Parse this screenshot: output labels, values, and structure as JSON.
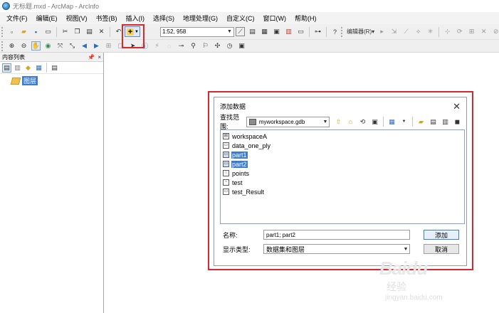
{
  "window": {
    "title": "无标题.mxd - ArcMap - ArcInfo"
  },
  "menubar": {
    "items": [
      {
        "label": "文件(F)"
      },
      {
        "label": "编辑(E)"
      },
      {
        "label": "视图(V)"
      },
      {
        "label": "书签(B)"
      },
      {
        "label": "插入(I)"
      },
      {
        "label": "选择(S)"
      },
      {
        "label": "地理处理(G)"
      },
      {
        "label": "自定义(C)"
      },
      {
        "label": "窗口(W)"
      },
      {
        "label": "帮助(H)"
      }
    ]
  },
  "toolbar": {
    "scale_value": "1:52, 958",
    "editor_label": "编辑器(R)▾"
  },
  "toc": {
    "title": "内容列表",
    "pin_label": "📌",
    "close_label": "×",
    "layers_label": "图层"
  },
  "dialog": {
    "title": "添加数据",
    "look_in_label": "查找范围:",
    "look_in_value": "myworkspace.gdb",
    "files": [
      {
        "name": "workspaceA",
        "icon": "feature-dataset-icon",
        "selected": false
      },
      {
        "name": "data_one_ply",
        "icon": "polygon-feature-class-icon",
        "selected": false
      },
      {
        "name": "part1",
        "icon": "polygon-feature-class-icon",
        "selected": true
      },
      {
        "name": "part2",
        "icon": "polygon-feature-class-icon",
        "selected": true
      },
      {
        "name": "points",
        "icon": "point-feature-class-icon",
        "selected": false
      },
      {
        "name": "test",
        "icon": "line-feature-class-icon",
        "selected": false
      },
      {
        "name": "test_Result",
        "icon": "polygon-feature-class-icon",
        "selected": false
      }
    ],
    "name_label": "名称:",
    "name_value": "part1; part2",
    "type_label": "显示类型:",
    "type_value": "数据集和图层",
    "add_button": "添加",
    "cancel_button": "取消",
    "close_label": "✕"
  },
  "colors": {
    "highlight_red": "#d9282d",
    "selection_blue": "#3a7bd5"
  }
}
